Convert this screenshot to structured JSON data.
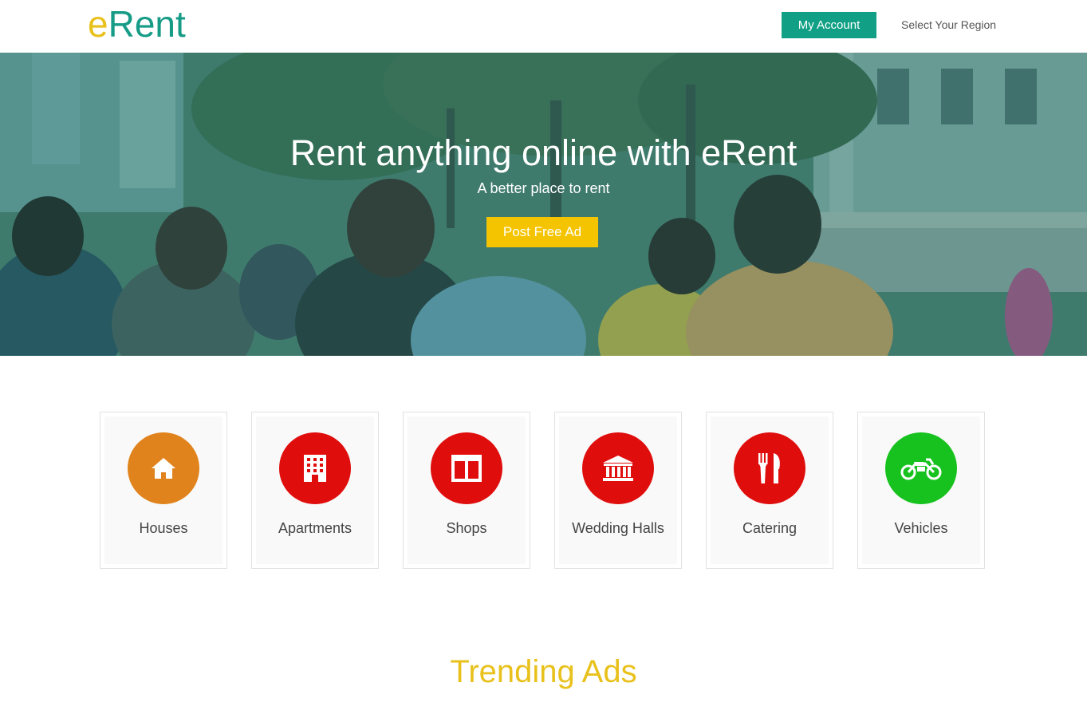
{
  "header": {
    "logo_e": "e",
    "logo_rent": "Rent",
    "account_label": "My Account",
    "region_label": "Select Your Region"
  },
  "hero": {
    "title": "Rent anything online with eRent",
    "subtitle": "A better place to rent",
    "cta_label": "Post Free Ad"
  },
  "categories": [
    {
      "label": "Houses",
      "icon": "house-icon",
      "color": "#e0831c"
    },
    {
      "label": "Apartments",
      "icon": "building-icon",
      "color": "#e00d0d"
    },
    {
      "label": "Shops",
      "icon": "shop-icon",
      "color": "#e00d0d"
    },
    {
      "label": "Wedding Halls",
      "icon": "hall-icon",
      "color": "#e00d0d"
    },
    {
      "label": "Catering",
      "icon": "cutlery-icon",
      "color": "#e00d0d"
    },
    {
      "label": "Vehicles",
      "icon": "motorcycle-icon",
      "color": "#17c21f"
    }
  ],
  "trending": {
    "title": "Trending Ads"
  },
  "colors": {
    "brand_green": "#11a085",
    "brand_yellow": "#e9c11c",
    "cta_yellow": "#f5c400"
  }
}
